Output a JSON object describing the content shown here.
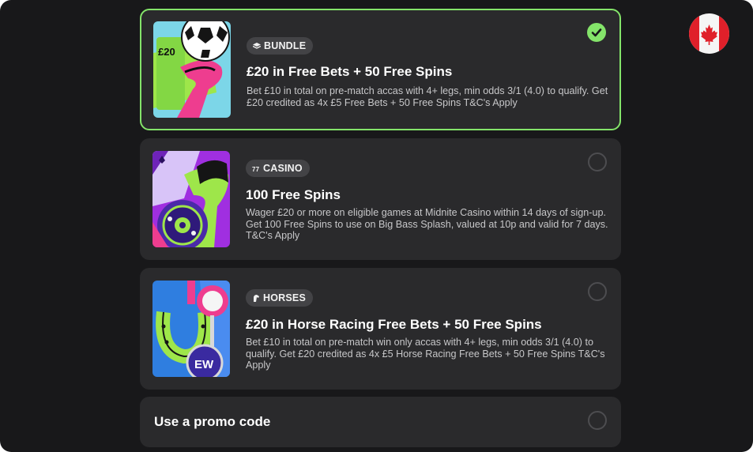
{
  "offers": [
    {
      "badge": "BUNDLE",
      "badge_icon": "layers-icon",
      "title": "£20 in Free Bets + 50 Free Spins",
      "description": "Bet £10 in total on pre-match accas with 4+ legs, min odds 3/1 (4.0) to qualify. Get £20 credited as 4x £5 Free Bets + 50 Free Spins T&C's Apply",
      "selected": true,
      "thumb_text": "£20"
    },
    {
      "badge": "CASINO",
      "badge_icon": "casino-777-icon",
      "title": "100 Free Spins",
      "description": "Wager £20 or more on eligible games at Midnite Casino within 14 days of sign-up. Get 100 Free Spins to use on Big Bass Splash, valued at 10p and valid for 7 days. T&C's Apply",
      "selected": false
    },
    {
      "badge": "HORSES",
      "badge_icon": "horse-head-icon",
      "title": "£20 in Horse Racing Free Bets + 50 Free Spins",
      "description": "Bet £10 in total on pre-match win only accas with 4+ legs, min odds 3/1 (4.0) to qualify. Get £20 credited as 4x £5 Horse Racing Free Bets + 50 Free Spins T&C's Apply",
      "selected": false,
      "thumb_text": "EW"
    }
  ],
  "promo": {
    "label": "Use a promo code"
  },
  "colors": {
    "background": "#18181a",
    "card": "#2a2a2c",
    "accent_green": "#84e46a",
    "badge_bg": "#434346"
  },
  "country_flag": "canada-flag-icon"
}
